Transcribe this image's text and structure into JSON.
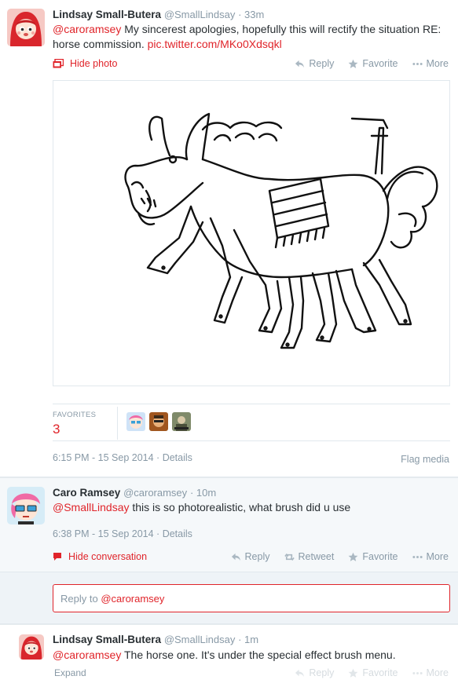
{
  "tweet1": {
    "name": "Lindsay Small-Butera",
    "handle": "@SmallLindsay",
    "time": "· 33m",
    "mention": "@caroramsey",
    "text": " My sincerest apologies, hopefully this will rectify the situation RE: horse commission. ",
    "link": "pic.twitter.com/MKo0Xdsqkl",
    "hide_photo": "Hide photo",
    "actions": {
      "reply": "Reply",
      "favorite": "Favorite",
      "more": "More"
    },
    "favorites_label": "FAVORITES",
    "favorites_count": "3",
    "timestamp": "6:15 PM - 15 Sep 2014",
    "details": "Details",
    "flag_media": "Flag media"
  },
  "tweet2": {
    "name": "Caro Ramsey",
    "handle": "@caroramsey",
    "time": "· 10m",
    "mention": "@SmallLindsay",
    "text": " this is so photorealistic, what brush did u use",
    "timestamp": "6:38 PM - 15 Sep 2014",
    "details": "Details",
    "hide_conversation": "Hide conversation",
    "actions": {
      "reply": "Reply",
      "retweet": "Retweet",
      "favorite": "Favorite",
      "more": "More"
    }
  },
  "reply_box": {
    "prefix": "Reply to ",
    "mention": "@caroramsey"
  },
  "tweet3": {
    "name": "Lindsay Small-Butera",
    "handle": "@SmallLindsay",
    "time": "· 1m",
    "mention": "@caroramsey",
    "text": " The horse one. It's under the special effect brush menu.",
    "expand": "Expand",
    "actions": {
      "reply": "Reply",
      "favorite": "Favorite",
      "more": "More"
    }
  },
  "colors": {
    "accent": "#e0242a",
    "muted": "#8899a6",
    "text": "#292f33"
  }
}
